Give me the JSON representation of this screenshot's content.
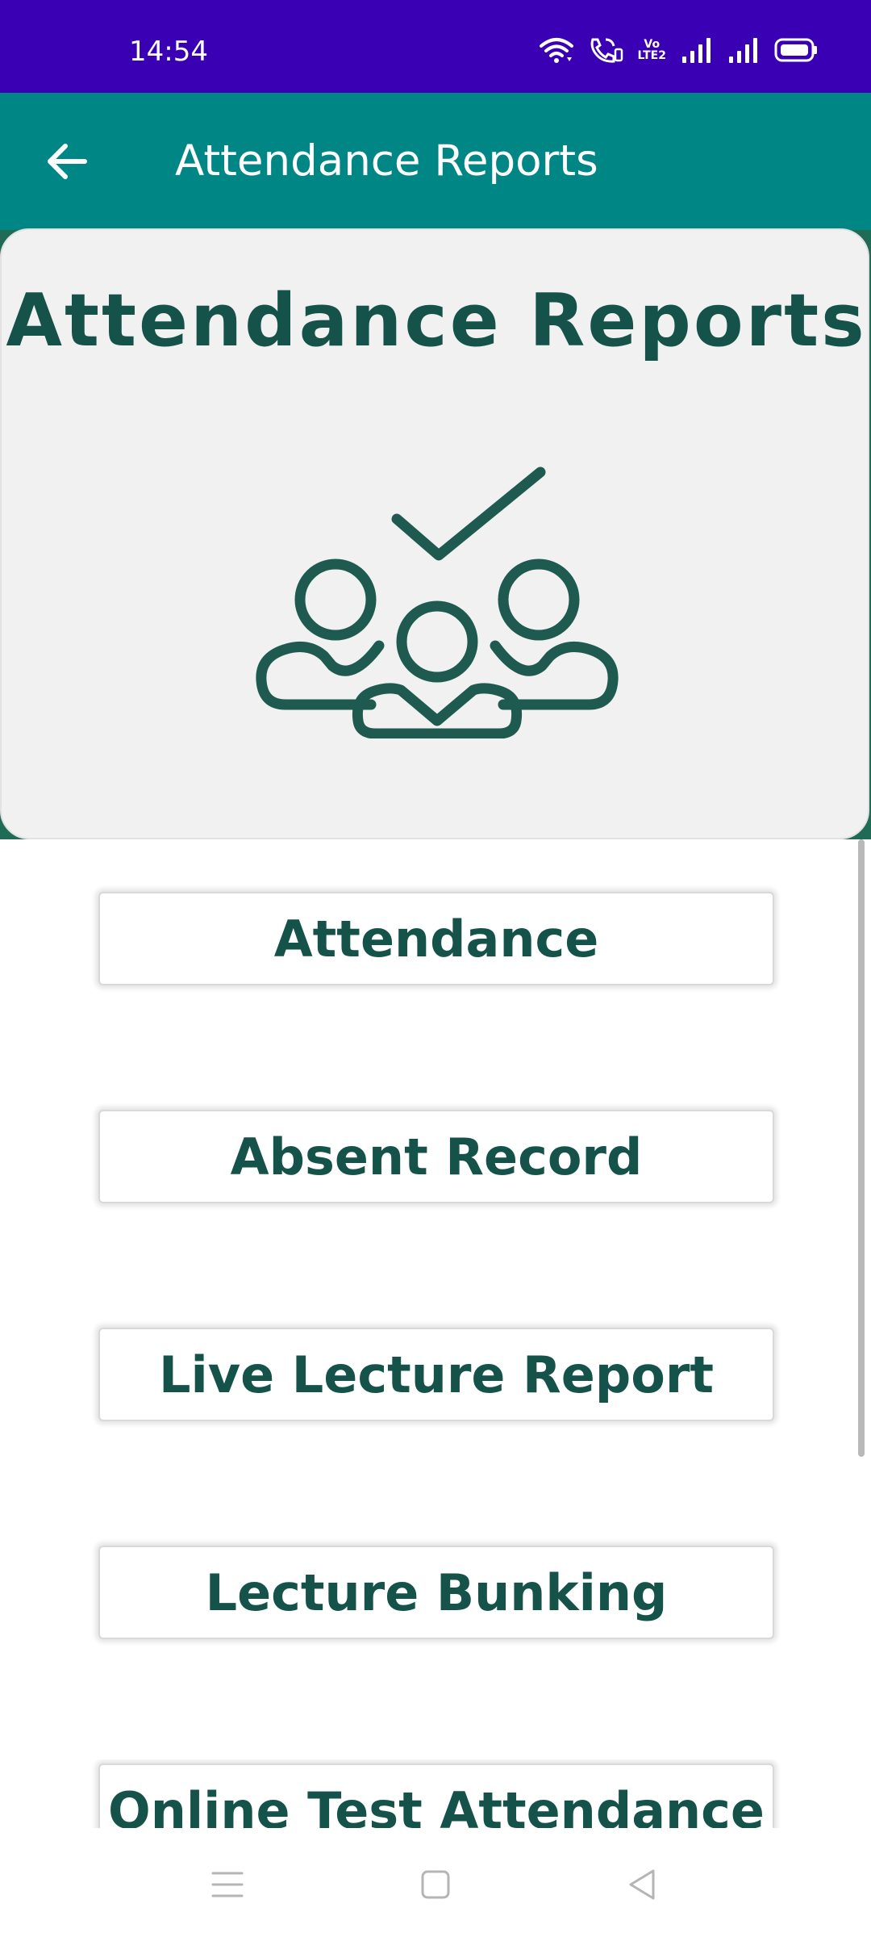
{
  "status_bar": {
    "time": "14:54",
    "icons": [
      "wifi-icon",
      "wifi-calling-icon",
      "volte-icon",
      "signal-icon",
      "signal-icon",
      "battery-icon"
    ],
    "volte_text_top": "Vo",
    "volte_text_bottom": "LTE2"
  },
  "app_bar": {
    "title": "Attendance Reports",
    "back_icon": "arrow-left-icon"
  },
  "hero": {
    "title": "Attendance Reports",
    "illustration": "group-attendance-check-icon"
  },
  "menu": {
    "items": [
      {
        "label": "Attendance"
      },
      {
        "label": "Absent Record"
      },
      {
        "label": "Live Lecture Report"
      },
      {
        "label": "Lecture Bunking"
      },
      {
        "label": "Online Test Attendance"
      }
    ]
  },
  "nav_bar": {
    "icons": [
      "menu-icon",
      "home-icon",
      "back-icon"
    ]
  },
  "colors": {
    "status_bar": "#3a00b4",
    "app_bar": "#008785",
    "accent_text": "#14524a",
    "card_bg": "#f1f1f1"
  }
}
